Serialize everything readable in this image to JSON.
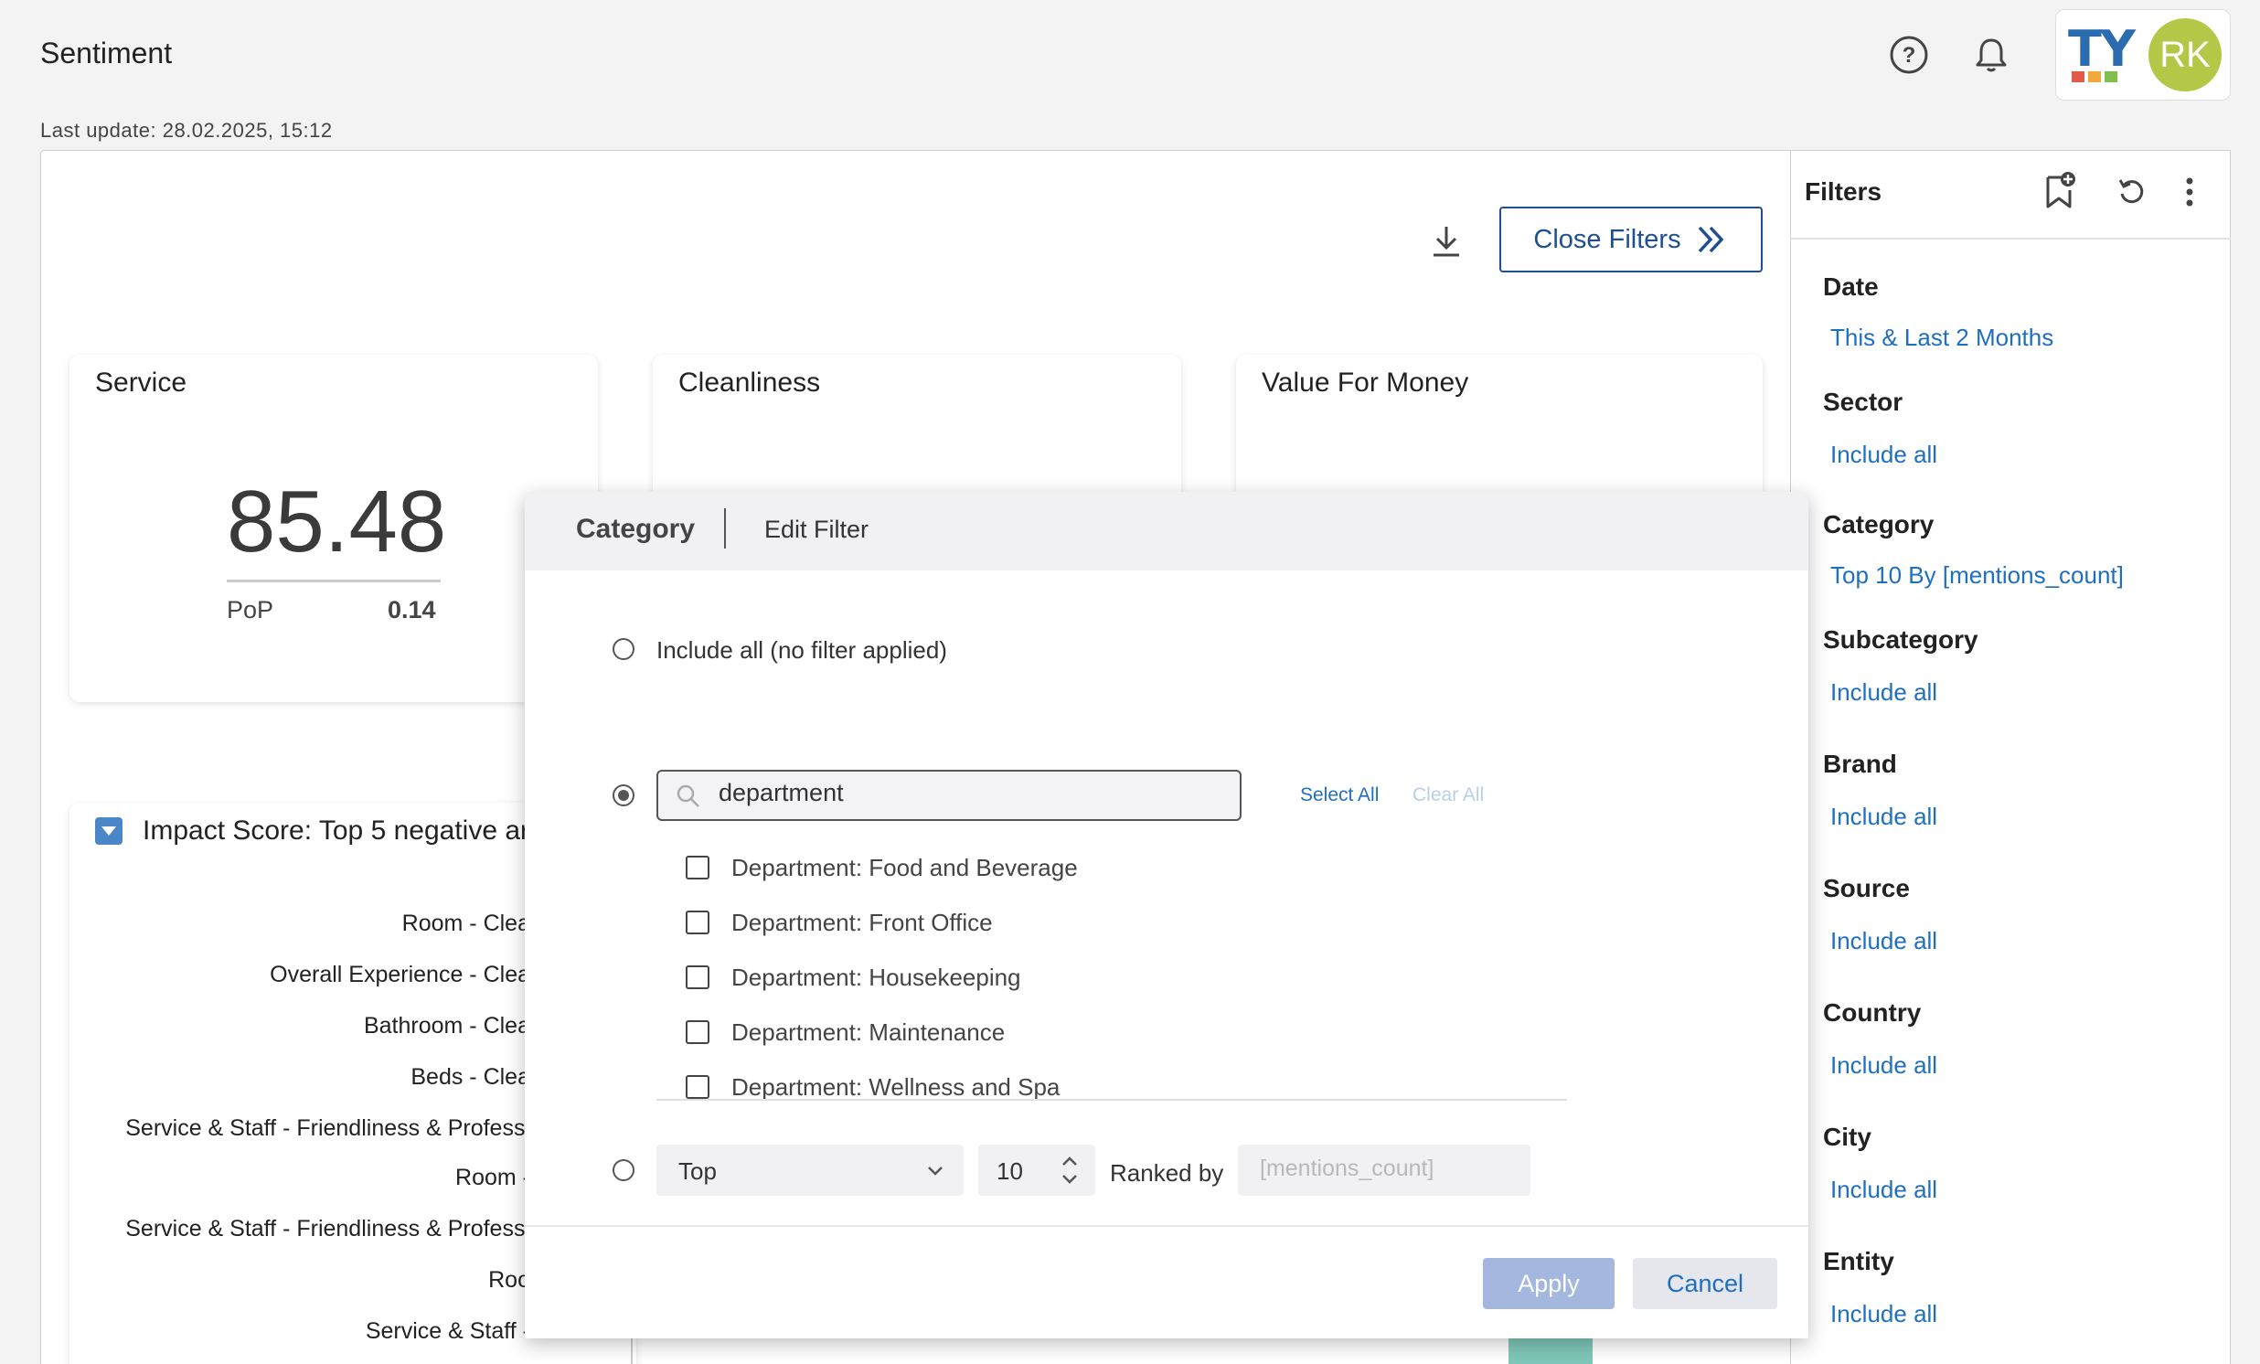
{
  "header": {
    "title": "Sentiment",
    "last_update": "Last update: 28.02.2025, 15:12",
    "logo_text": "TY",
    "avatar_initials": "RK"
  },
  "toolbar": {
    "close_filters_label": "Close Filters"
  },
  "cards": [
    {
      "title": "Service",
      "value": "85.48",
      "pop_label": "PoP",
      "pop_value": "0.14"
    },
    {
      "title": "Cleanliness"
    },
    {
      "title": "Value For Money"
    }
  ],
  "impact": {
    "title": "Impact Score: Top 5 negative ar",
    "rows": [
      "Room - Clea",
      "Overall Experience - Clea",
      "Bathroom - Clea",
      "Beds - Clea",
      "Service & Staff - Friendliness & Professi",
      "Room -",
      "Service & Staff - Friendliness & Professi",
      "Roo",
      "Service & Staff -"
    ]
  },
  "filters": {
    "title": "Filters",
    "items": [
      {
        "label": "Date",
        "value": "This & Last 2 Months"
      },
      {
        "label": "Sector",
        "value": "Include all"
      },
      {
        "label": "Category",
        "value": "Top 10 By [mentions_count]"
      },
      {
        "label": "Subcategory",
        "value": "Include all"
      },
      {
        "label": "Brand",
        "value": "Include all"
      },
      {
        "label": "Source",
        "value": "Include all"
      },
      {
        "label": "Country",
        "value": "Include all"
      },
      {
        "label": "City",
        "value": "Include all"
      },
      {
        "label": "Entity",
        "value": "Include all"
      }
    ]
  },
  "modal": {
    "tab_category": "Category",
    "tab_edit": "Edit Filter",
    "include_all_label": "Include all (no filter applied)",
    "search_value": "department",
    "select_all": "Select All",
    "clear_all": "Clear All",
    "options": [
      "Department: Food and Beverage",
      "Department: Front Office",
      "Department: Housekeeping",
      "Department: Maintenance",
      "Department: Wellness and Spa"
    ],
    "top_select": "Top",
    "top_count": "10",
    "ranked_by_label": "Ranked by",
    "ranked_by_placeholder": "[mentions_count]",
    "apply_label": "Apply",
    "cancel_label": "Cancel"
  },
  "colors": {
    "primary_blue": "#1f4f93",
    "link_blue": "#1f6fc1",
    "avatar_green": "#b4c746",
    "apply_disabled": "#a4b8df"
  }
}
